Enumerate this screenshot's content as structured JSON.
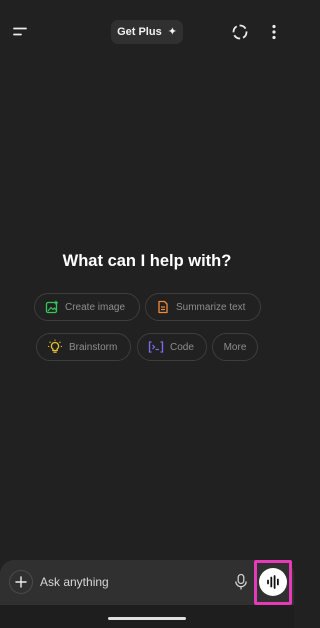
{
  "header": {
    "menu_icon": "menu-icon",
    "get_plus_label": "Get Plus",
    "get_plus_icon": "sparkle-icon",
    "temporary_chat_icon": "dashed-circle-icon",
    "more_icon": "vertical-dots-icon"
  },
  "main": {
    "headline": "What can I help with?"
  },
  "suggestions": {
    "create_image": {
      "label": "Create image",
      "icon": "image-plus-icon",
      "color": "#34c759"
    },
    "summarize_text": {
      "label": "Summarize text",
      "icon": "document-icon",
      "color": "#f08a3a"
    },
    "brainstorm": {
      "label": "Brainstorm",
      "icon": "lightbulb-icon",
      "color": "#e8c430"
    },
    "code": {
      "label": "Code",
      "icon": "terminal-icon",
      "color": "#7b6cf0"
    },
    "more": {
      "label": "More"
    }
  },
  "composer": {
    "placeholder": "Ask anything",
    "plus_icon": "plus-icon",
    "mic_icon": "microphone-icon",
    "voice_icon": "voice-waveform-icon",
    "highlight_color": "#e63ab8"
  }
}
